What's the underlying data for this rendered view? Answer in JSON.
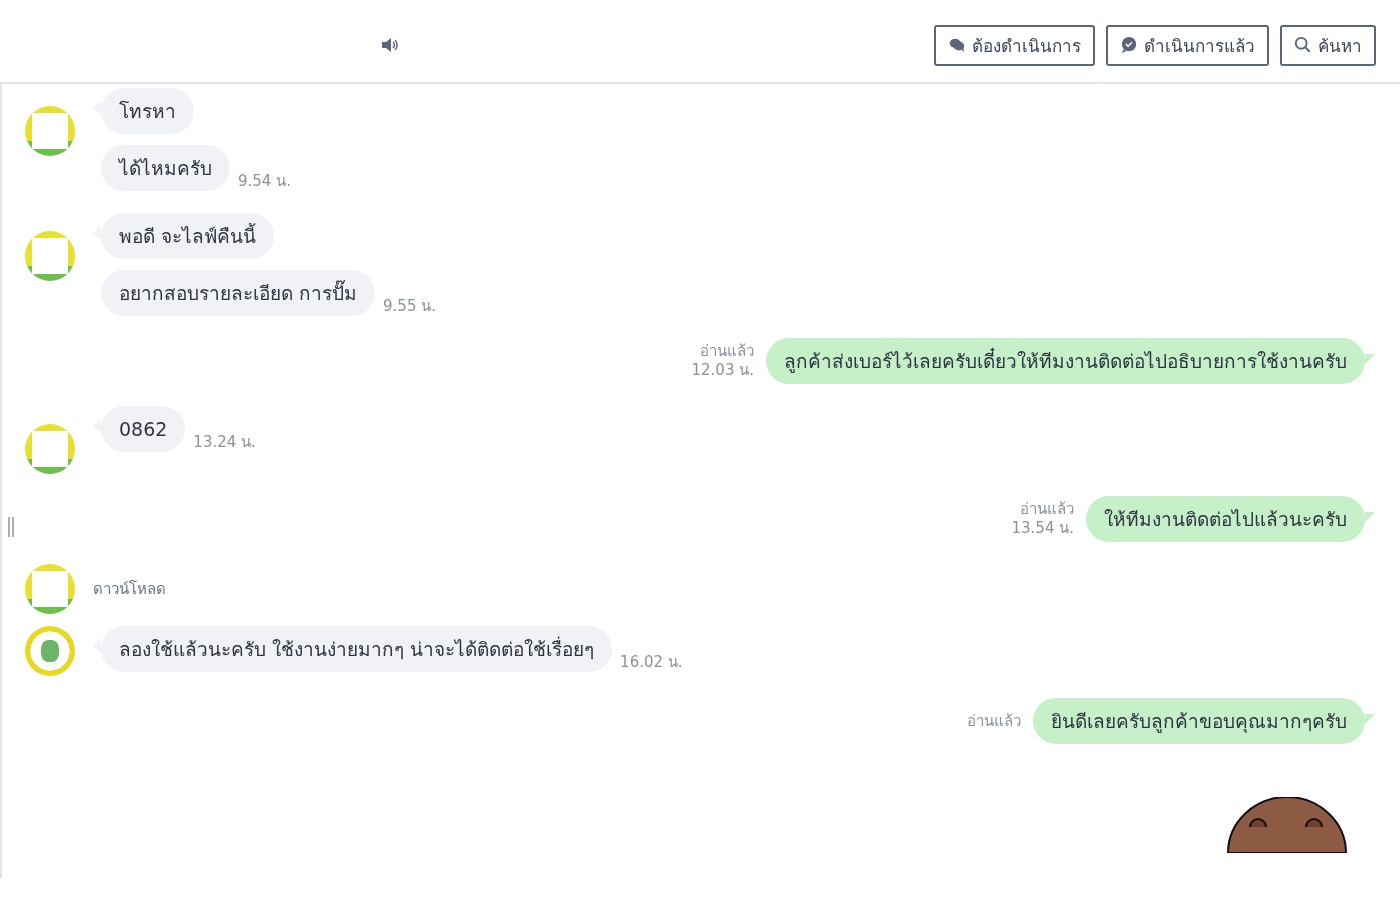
{
  "header": {
    "buttons": [
      {
        "label": "ต้องดำเนินการ"
      },
      {
        "label": "ดำเนินการแล้ว"
      },
      {
        "label": "ค้นหา"
      }
    ]
  },
  "messages": [
    {
      "kind": "in",
      "bubbles": [
        "โทรหา",
        "ได้ไหมครับ"
      ],
      "time": "9.54 น."
    },
    {
      "kind": "in",
      "bubbles": [
        "พอดี จะไลฟ์คืนนี้",
        "อยากสอบรายละเอียด การปั๊ม"
      ],
      "time": "9.55 น."
    },
    {
      "kind": "out",
      "text": "ลูกค้าส่งเบอร์ไว้เลยครับเดี๋ยวให้ทีมงานติดต่อไปอธิบายการใช้งานครับ",
      "read": "อ่านแล้ว",
      "time": "12.03 น."
    },
    {
      "kind": "in",
      "bubbles": [
        "0862"
      ],
      "time": "13.24 น."
    },
    {
      "kind": "out",
      "text": "ให้ทีมงานติดต่อไปแล้วนะครับ",
      "read": "อ่านแล้ว",
      "time": "13.54 น."
    },
    {
      "kind": "download",
      "label": "ดาวน์โหลด"
    },
    {
      "kind": "in",
      "bubbles": [
        "ลองใช้แล้วนะครับ ใช้งานง่ายมากๆ น่าจะได้ติดต่อใช้เรื่อยๆ"
      ],
      "time": "16.02 น."
    },
    {
      "kind": "out",
      "text": "ยินดีเลยครับลูกค้าขอบคุณมากๆครับ",
      "read": "อ่านแล้ว"
    },
    {
      "kind": "sticker"
    }
  ]
}
